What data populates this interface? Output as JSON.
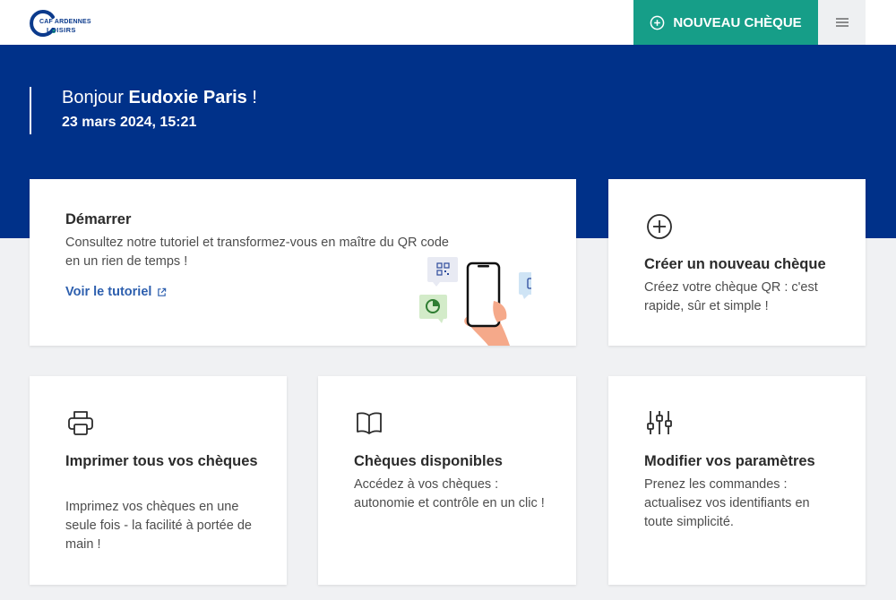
{
  "header": {
    "logo_top": "CAF ARDENNES",
    "logo_bottom": "LOISIRS",
    "new_cheque_label": "NOUVEAU CHÈQUE",
    "menu_icon": "hamburger-icon"
  },
  "hero": {
    "greeting_prefix": "Bonjour ",
    "user_name": "Eudoxie Paris",
    "greeting_suffix": " !",
    "datetime": "23 mars 2024, 15:21"
  },
  "cards": {
    "start": {
      "title": "Démarrer",
      "text": "Consultez notre tutoriel et transformez-vous en maître du QR code en un rien de temps !",
      "link_label": "Voir le tutoriel",
      "link_icon": "external-link-icon"
    },
    "create": {
      "icon": "plus-circle-icon",
      "title": "Créer un nouveau chèque",
      "text": "Créez votre chèque QR : c'est rapide, sûr et simple !"
    },
    "print": {
      "icon": "printer-icon",
      "title": "Imprimer tous vos chèques",
      "text": "Imprimez vos chèques en une seule fois - la facilité à portée de main !"
    },
    "available": {
      "icon": "book-icon",
      "title": "Chèques disponibles",
      "text": "Accédez à vos chèques : autonomie et contrôle en un clic !"
    },
    "settings": {
      "icon": "sliders-icon",
      "title": "Modifier vos paramètres",
      "text": "Prenez les commandes : actualisez vos identifiants en toute simplicité."
    }
  },
  "colors": {
    "brand_blue": "#003189",
    "accent_teal": "#169e88",
    "link_blue": "#2d5fae",
    "background": "#f0f1f3"
  }
}
